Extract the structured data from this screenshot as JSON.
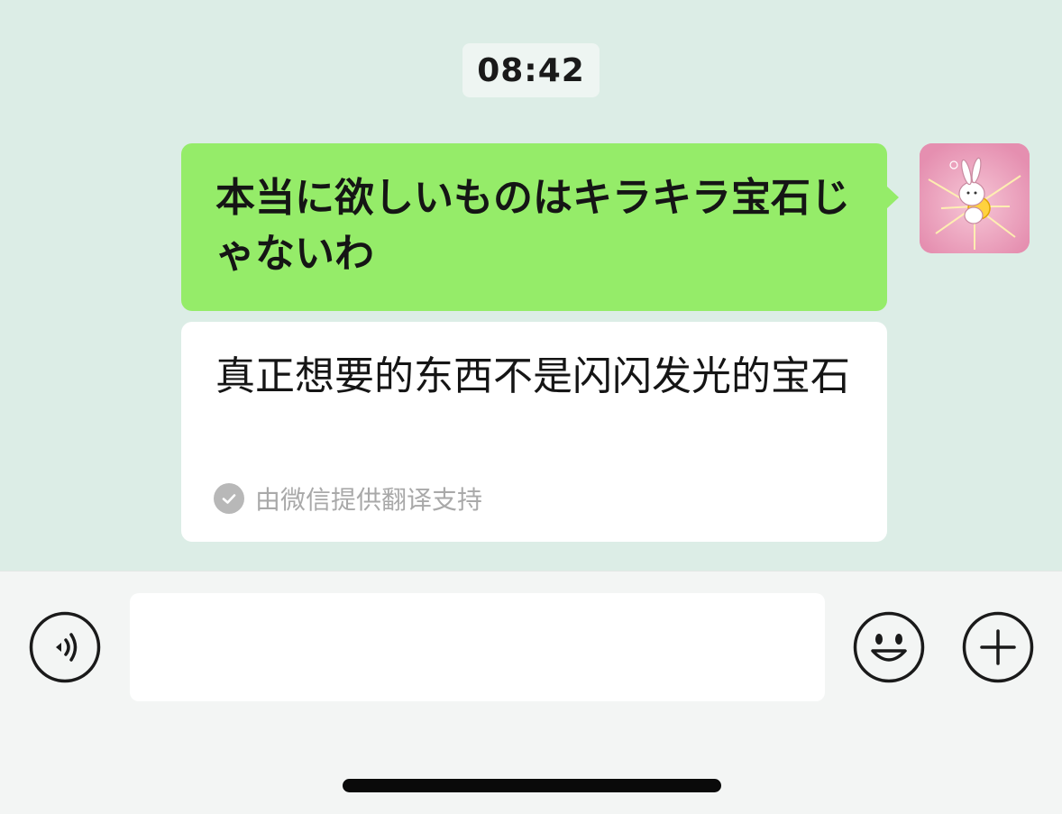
{
  "chat": {
    "timestamp": "08:42",
    "messages": [
      {
        "text": "本当に欲しいものはキラキラ宝石じゃないわ",
        "translation": "真正想要的东西不是闪闪发光的宝石",
        "translation_note": "由微信提供翻译支持",
        "avatar": "bunny-sticker-avatar"
      }
    ]
  },
  "input_bar": {
    "value": "",
    "placeholder": "",
    "voice_icon": "voice-mode-icon",
    "emoji_icon": "emoji-icon",
    "plus_icon": "plus-icon"
  },
  "colors": {
    "chat_background": "#dcede6",
    "sent_bubble": "#95ec69",
    "translation_card": "#ffffff",
    "input_bar": "#f3f5f4"
  }
}
